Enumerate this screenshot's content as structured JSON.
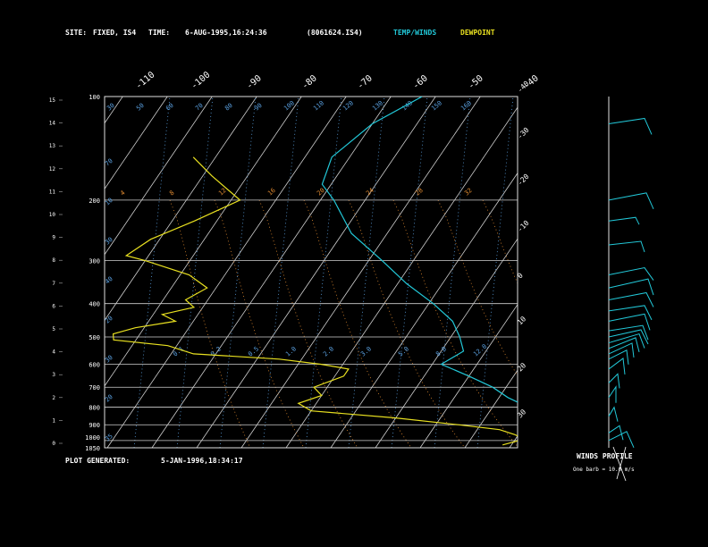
{
  "header": {
    "site_label": "SITE:",
    "site_value": "FIXED, IS4",
    "time_label": "TIME:",
    "time_value": "6-AUG-1995,16:24:36",
    "file_id": "(8061624.IS4)",
    "legend_temp": "TEMP/WINDS",
    "legend_dew": "DEWPOINT"
  },
  "footer": {
    "generated_label": "PLOT GENERATED:",
    "generated_value": "5-JAN-1996,18:34:17"
  },
  "winds_panel": {
    "title": "WINDS PROFILE",
    "note": "One barb = 10.0 m/s"
  },
  "colors": {
    "temp": "#22c8d8",
    "dew": "#e8e020",
    "grid": "#cfcfcf",
    "mixing": "#5aa0e0",
    "adiabat": "#e08a30"
  },
  "chart_data": {
    "type": "line",
    "title": "",
    "pressure_levels": [
      100,
      200,
      300,
      400,
      500,
      600,
      700,
      800,
      900,
      1000,
      1050
    ],
    "pressure_labels": [
      "100",
      "200",
      "300",
      "400",
      "500",
      "600",
      "700",
      "800",
      "900",
      "1000",
      "1050"
    ],
    "left_ticks": [
      "0",
      "1",
      "2",
      "3",
      "4",
      "5",
      "6",
      "7",
      "8",
      "9",
      "10",
      "11",
      "12",
      "13",
      "14",
      "15"
    ],
    "right_ticks": [
      "-40",
      "-30",
      "-20",
      "-10",
      "0",
      "10",
      "20",
      "30"
    ],
    "top_ticks": [
      "-110",
      "-100",
      "-90",
      "-80",
      "-70",
      "-60",
      "-50",
      "-40"
    ],
    "mixing_labels": [
      "0.1",
      "0.2",
      "0.5",
      "1.0",
      "2.0",
      "3.0",
      "5.0",
      "8.0",
      "12.0"
    ],
    "theta_top_labels": [
      "30",
      "50",
      "60",
      "70",
      "80",
      "90",
      "100",
      "110",
      "120",
      "130",
      "140",
      "150",
      "160"
    ],
    "theta_left_labels": [
      "70",
      "10",
      "30",
      "40",
      "20",
      "30",
      "20",
      "35"
    ],
    "theta_mid_labels": [
      "4",
      "8",
      "12",
      "16",
      "20",
      "24",
      "28",
      "32"
    ],
    "series": [
      {
        "name": "TEMP/WINDS",
        "pressure": [
          100,
          120,
          150,
          180,
          200,
          250,
          300,
          350,
          400,
          450,
          500,
          550,
          600,
          650,
          700,
          750,
          800,
          850,
          900,
          950,
          1000,
          1030
        ],
        "value": [
          -63,
          -70,
          -74,
          -72,
          -67,
          -58,
          -47,
          -38,
          -29,
          -22,
          -18,
          -15,
          -18,
          -10,
          -3,
          2,
          8,
          14,
          19,
          22,
          24,
          30
        ]
      },
      {
        "name": "DEWPOINT",
        "pressure": [
          150,
          170,
          200,
          230,
          260,
          290,
          300,
          330,
          360,
          390,
          410,
          430,
          450,
          470,
          490,
          510,
          530,
          560,
          580,
          600,
          620,
          650,
          700,
          740,
          780,
          820,
          860,
          900,
          930,
          960,
          990,
          1000,
          1030
        ],
        "value": [
          -105,
          -98,
          -88,
          -95,
          -102,
          -105,
          -100,
          -88,
          -82,
          -85,
          -82,
          -88,
          -84,
          -92,
          -96,
          -95,
          -82,
          -75,
          -55,
          -45,
          -38,
          -38,
          -43,
          -40,
          -44,
          -40,
          -20,
          -5,
          5,
          9,
          12,
          11,
          8
        ]
      }
    ],
    "winds": [
      {
        "pressure": 120,
        "a": [
          40,
          -6
        ],
        "b": [
          48,
          12
        ]
      },
      {
        "pressure": 200,
        "a": [
          42,
          -8
        ],
        "b": [
          50,
          10
        ]
      },
      {
        "pressure": 230,
        "a": [
          30,
          -4
        ],
        "b": [
          34,
          4
        ]
      },
      {
        "pressure": 270,
        "a": [
          36,
          -4
        ],
        "b": [
          40,
          8
        ]
      },
      {
        "pressure": 330,
        "a": [
          40,
          -8
        ],
        "b": [
          50,
          6
        ]
      },
      {
        "pressure": 360,
        "a": [
          44,
          -10
        ],
        "b": [
          50,
          8
        ]
      },
      {
        "pressure": 390,
        "a": [
          42,
          -8
        ],
        "b": [
          50,
          8
        ]
      },
      {
        "pressure": 420,
        "a": [
          40,
          -6
        ],
        "b": [
          48,
          10
        ]
      },
      {
        "pressure": 450,
        "a": [
          40,
          -8
        ],
        "b": [
          46,
          10
        ]
      },
      {
        "pressure": 480,
        "a": [
          38,
          -6
        ],
        "b": [
          44,
          10
        ]
      },
      {
        "pressure": 500,
        "a": [
          36,
          -8
        ],
        "b": [
          44,
          8
        ]
      },
      {
        "pressure": 520,
        "a": [
          34,
          -10
        ],
        "b": [
          40,
          6
        ]
      },
      {
        "pressure": 540,
        "a": [
          30,
          -12
        ],
        "b": [
          34,
          4
        ]
      },
      {
        "pressure": 560,
        "a": [
          26,
          -12
        ],
        "b": [
          28,
          4
        ]
      },
      {
        "pressure": 580,
        "a": [
          20,
          -10
        ],
        "b": [
          22,
          6
        ]
      },
      {
        "pressure": 620,
        "a": [
          16,
          -12
        ],
        "b": [
          18,
          6
        ]
      },
      {
        "pressure": 680,
        "a": [
          10,
          -10
        ],
        "b": [
          12,
          6
        ]
      },
      {
        "pressure": 750,
        "a": [
          8,
          -12
        ],
        "b": [
          8,
          6
        ]
      },
      {
        "pressure": 850,
        "a": [
          6,
          -10
        ],
        "b": [
          10,
          6
        ]
      },
      {
        "pressure": 950,
        "a": [
          12,
          -8
        ],
        "b": [
          16,
          8
        ]
      },
      {
        "pressure": 1000,
        "a": [
          20,
          -10
        ],
        "b": [
          28,
          8
        ]
      }
    ]
  }
}
